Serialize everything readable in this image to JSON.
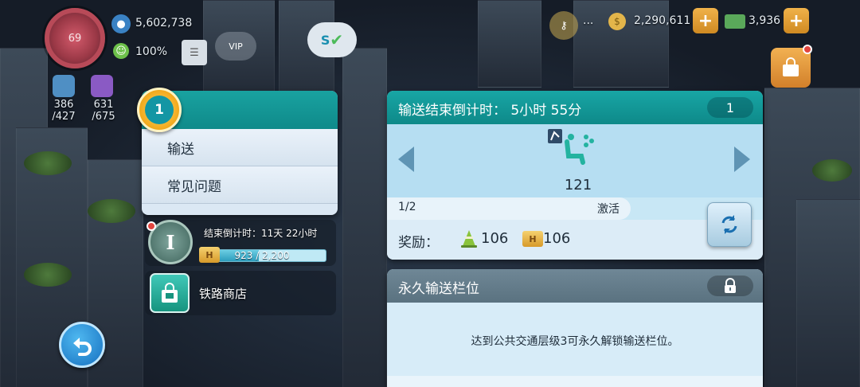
{
  "hud": {
    "level": "69",
    "population": "5,602,738",
    "happiness": "100%",
    "water_top": "386",
    "water_bottom": "/427",
    "sewage_top": "631",
    "sewage_bottom": "/675",
    "simcash": "2,290,611",
    "simoleons": "3,936",
    "vip_label": "VIP",
    "ellipsis": "..."
  },
  "menu": {
    "badge_number": "1",
    "items": [
      {
        "label": "输送"
      },
      {
        "label": "常见问题"
      }
    ]
  },
  "event": {
    "time_label": "结束倒计时：11天 22小时",
    "progress_text": "923 / 2,200",
    "progress_value": 923,
    "progress_max": 2200
  },
  "shop": {
    "label": "铁路商店"
  },
  "transport": {
    "title": "输送结束倒计时：  5小时 55分",
    "slot_count": "1",
    "item_count": "121",
    "page": "1/2",
    "activate_label": "激活",
    "reward_label": "奖励：",
    "reward_cone": "106",
    "reward_ticket": "106"
  },
  "permanent": {
    "title": "永久输送栏位",
    "message": "达到公共交通层级3可永久解锁输送栏位。"
  },
  "colors": {
    "teal_header": "#13999a",
    "panel_bg": "#c8e7f5",
    "locked_header": "#657d8b",
    "gold": "#f2a91c"
  }
}
